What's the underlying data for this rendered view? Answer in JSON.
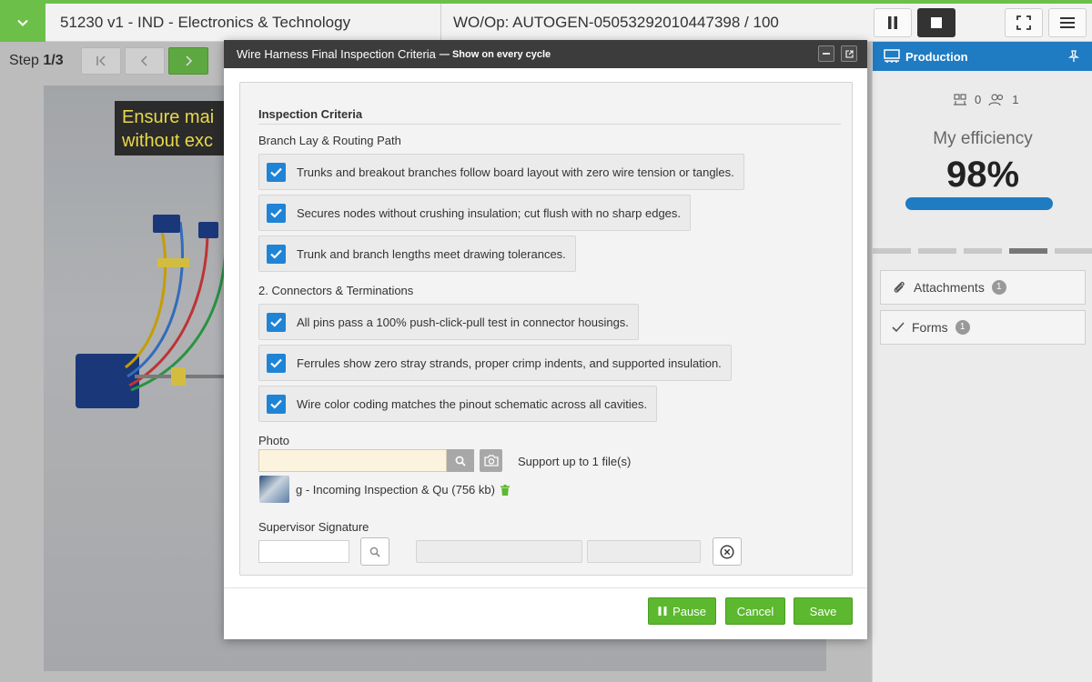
{
  "header": {
    "title": "51230 v1 - IND - Electronics & Technology",
    "work_order": "WO/Op:  AUTOGEN-05053292010447398 / 100"
  },
  "step": {
    "prefix": "Step ",
    "current": "1/3"
  },
  "content": {
    "banner_line1": "Ensure mai",
    "banner_line2": "without exc"
  },
  "right_panel": {
    "production_label": "Production",
    "counter_a": "0",
    "counter_b": "1",
    "efficiency_label": "My efficiency",
    "efficiency_value": "98%",
    "efficiency_fraction": 1.0,
    "attachments_label": "Attachments",
    "attachments_count": "1",
    "forms_label": "Forms",
    "forms_count": "1"
  },
  "modal": {
    "title": "Wire Harness Final Inspection Criteria",
    "subtitle": "— Show on every cycle",
    "section_title": "Inspection Criteria",
    "group1_label": "Branch Lay & Routing Path",
    "group1_items": [
      "Trunks and breakout branches follow board layout with zero wire tension or tangles.",
      "Secures nodes without crushing insulation; cut flush with no sharp edges.",
      "Trunk and branch lengths meet drawing tolerances."
    ],
    "group2_label": "2. Connectors & Terminations",
    "group2_items": [
      "All pins pass a 100% push-click-pull test in connector housings.",
      "Ferrules show zero stray strands, proper crimp indents, and supported insulation.",
      "Wire color coding matches the pinout schematic across all cavities."
    ],
    "photo_label": "Photo",
    "support_text": "Support up to 1 file(s)",
    "file_name": "g - Incoming Inspection & Qu (756 kb)",
    "signature_label": "Supervisor Signature",
    "pause_label": "Pause",
    "cancel_label": "Cancel",
    "save_label": "Save"
  },
  "colors": {
    "accent_green": "#6cc04a",
    "primary_blue": "#1f7bc2",
    "checkbox_blue": "#1f84d6",
    "button_green": "#5cb82e"
  }
}
